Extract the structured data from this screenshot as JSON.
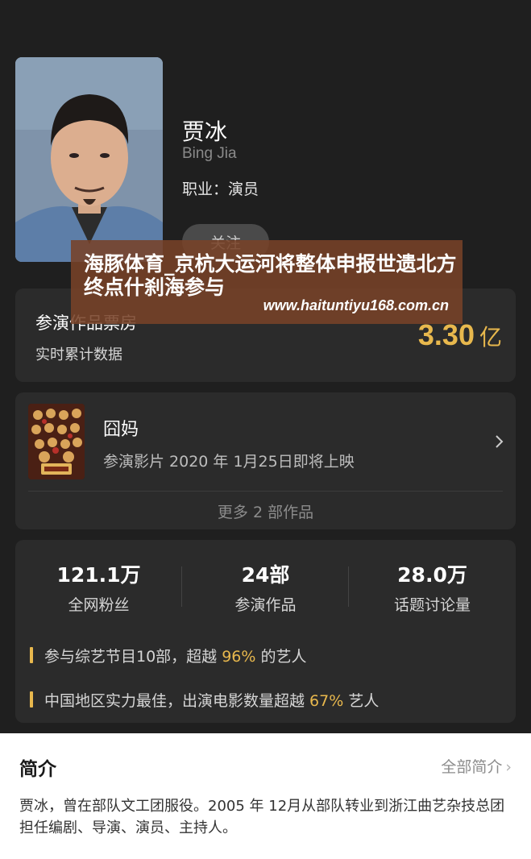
{
  "profile": {
    "name": "贾冰",
    "english_name": "Bing Jia",
    "occupation": "职业：演员",
    "follow_label": "关注"
  },
  "box_office": {
    "title": "参演作品票房",
    "subtitle": "实时累计数据",
    "value": "3.30",
    "unit": "亿"
  },
  "works": {
    "title": "囧妈",
    "subtitle": "参演影片 2020 年 1月25日即将上映",
    "more": "更多 2 部作品"
  },
  "stats": [
    {
      "value": "121.1万",
      "label": "全网粉丝"
    },
    {
      "value": "24部",
      "label": "参演作品"
    },
    {
      "value": "28.0万",
      "label": "话题讨论量"
    }
  ],
  "highlights": [
    {
      "before": "参与综艺节目10部，超越 ",
      "highlight": "96%",
      "after": " 的艺人"
    },
    {
      "before": "中国地区实力最佳，出演电影数量超越 ",
      "highlight": "67%",
      "after": " 艺人"
    }
  ],
  "intro": {
    "title": "简介",
    "all_label": "全部简介",
    "text": "贾冰，曾在部队文工团服役。2005 年 12月从部队转业到浙江曲艺杂技总团担任编剧、导演、演员、主持人。"
  },
  "watermark": {
    "title": "海豚体育_京杭大运河将整体申报世遗北方终点什刹海参与",
    "url": "www.haituntiyu168.com.cn"
  },
  "colors": {
    "background": "#1f1f1f",
    "card": "#2b2b2b",
    "accent": "#e8b84d"
  }
}
